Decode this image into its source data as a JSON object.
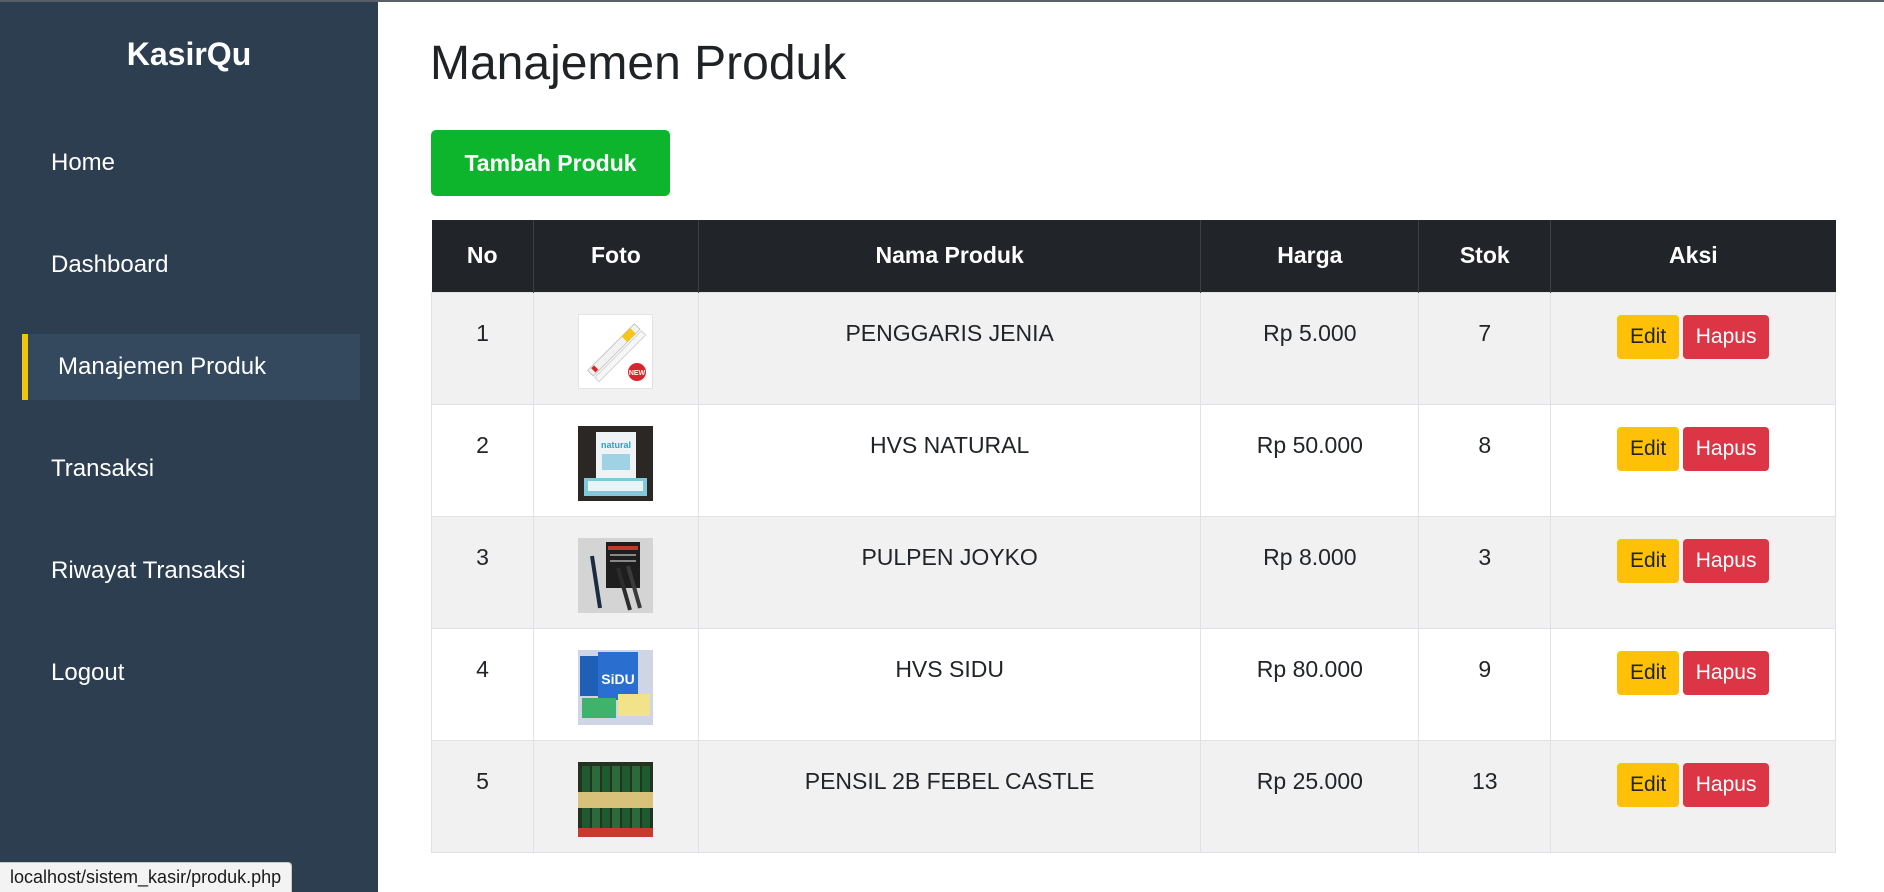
{
  "app": {
    "brand": "KasirQu"
  },
  "sidebar": {
    "items": [
      {
        "label": "Home",
        "active": false
      },
      {
        "label": "Dashboard",
        "active": false
      },
      {
        "label": "Manajemen Produk",
        "active": true
      },
      {
        "label": "Transaksi",
        "active": false
      },
      {
        "label": "Riwayat Transaksi",
        "active": false
      },
      {
        "label": "Logout",
        "active": false
      }
    ]
  },
  "main": {
    "title": "Manajemen Produk",
    "add_button_label": "Tambah Produk",
    "table": {
      "headers": [
        "No",
        "Foto",
        "Nama Produk",
        "Harga",
        "Stok",
        "Aksi"
      ],
      "rows": [
        {
          "no": "1",
          "nama": "PENGGARIS JENIA",
          "harga": "Rp 5.000",
          "stok": "7",
          "foto_icon": "ruler-product-image"
        },
        {
          "no": "2",
          "nama": "HVS NATURAL",
          "harga": "Rp 50.000",
          "stok": "8",
          "foto_icon": "paper-box-product-image"
        },
        {
          "no": "3",
          "nama": "PULPEN JOYKO",
          "harga": "Rp 8.000",
          "stok": "3",
          "foto_icon": "pen-product-image"
        },
        {
          "no": "4",
          "nama": "HVS SIDU",
          "harga": "Rp 80.000",
          "stok": "9",
          "foto_icon": "paper-ream-product-image"
        },
        {
          "no": "5",
          "nama": "PENSIL 2B FEBEL CASTLE",
          "harga": "Rp 25.000",
          "stok": "13",
          "foto_icon": "pencil-box-product-image"
        }
      ],
      "edit_label": "Edit",
      "delete_label": "Hapus"
    }
  },
  "status_bar": {
    "url": "localhost/sistem_kasir/produk.php"
  },
  "colors": {
    "sidebar_bg": "#2c3e50",
    "sidebar_active_bg": "#34495e",
    "active_indicator": "#f1c40f",
    "add_button": "#0db52d",
    "table_header": "#212529",
    "edit_button": "#ffc107",
    "delete_button": "#dc3545"
  }
}
